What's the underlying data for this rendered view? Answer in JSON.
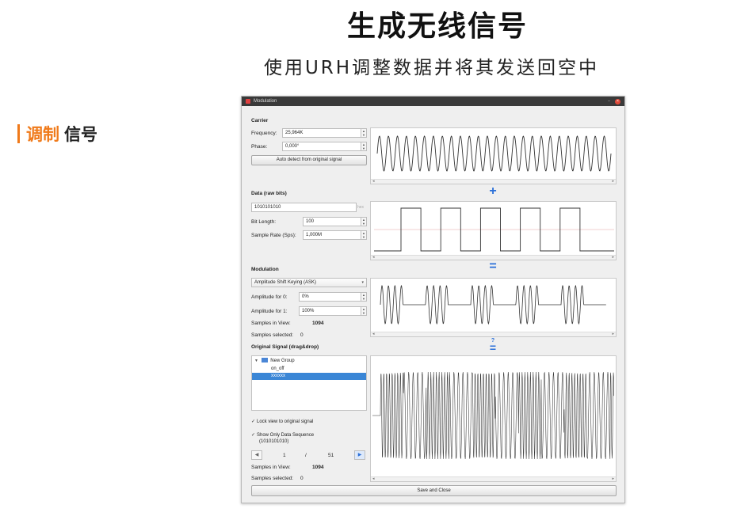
{
  "slide": {
    "title": "生成无线信号",
    "subtitle": "使用URH调整数据并将其发送回空中",
    "section_orange": "调制",
    "section_dark": "信号"
  },
  "window": {
    "title": "Modulation",
    "carrier": {
      "header": "Carrier",
      "frequency_label": "Frequency:",
      "frequency_value": "25,964K",
      "phase_label": "Phase:",
      "phase_value": "0,000°",
      "autodetect_label": "Auto detect from original signal"
    },
    "data": {
      "header": "Data (raw bits)",
      "bits_value": "1010101010",
      "bits_suffix": "hex",
      "bit_length_label": "Bit Length:",
      "bit_length_value": "100",
      "sample_rate_label": "Sample Rate (Sps):",
      "sample_rate_value": "1,000M"
    },
    "modulation": {
      "header": "Modulation",
      "type_value": "Amplitude Shift Keying (ASK)",
      "amp0_label": "Amplitude for 0:",
      "amp0_value": "0%",
      "amp1_label": "Amplitude for 1:",
      "amp1_value": "100%",
      "samples_view_label": "Samples in View:",
      "samples_view_value": "1094",
      "samples_selected_label": "Samples selected:",
      "samples_selected_value": "0"
    },
    "original": {
      "header": "Original Signal (drag&drop)",
      "tree_group": "New Group",
      "tree_item1": "on_off",
      "tree_item2": "xxxxxx",
      "lock_label": "Lock view to original signal",
      "show_only_label": "Show Only Data Sequence",
      "show_only_sub": "(1010101010)",
      "nav_current": "1",
      "nav_sep": "/",
      "nav_total": "51",
      "samples_view_label": "Samples in View:",
      "samples_view_value": "1094",
      "samples_selected_label": "Samples selected:",
      "samples_selected_value": "0"
    },
    "operators": {
      "plus": "+",
      "equals": "=",
      "question": "?"
    },
    "save_close_label": "Save and Close"
  },
  "colors": {
    "accent_orange": "#f07a1a",
    "operator_blue": "#2a6fd8",
    "selection_blue": "#3a86d6"
  }
}
